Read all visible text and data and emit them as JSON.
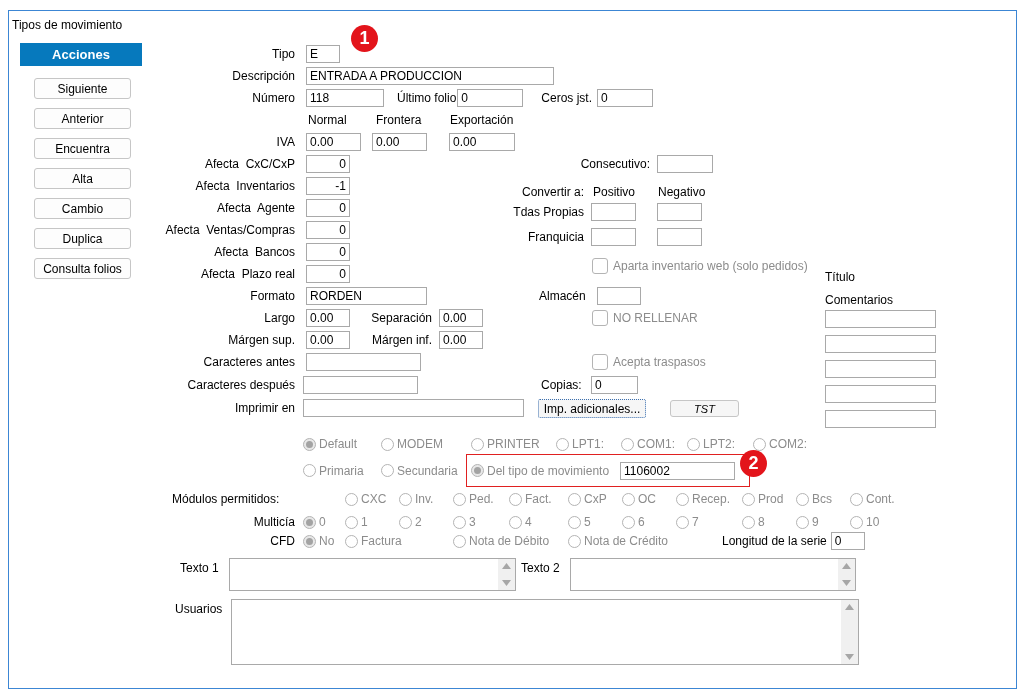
{
  "window": {
    "title": "Tipos de movimiento"
  },
  "actions": {
    "header": "Acciones",
    "buttons": [
      "Siguiente",
      "Anterior",
      "Encuentra",
      "Alta",
      "Cambio",
      "Duplica",
      "Consulta folios"
    ]
  },
  "tipo": {
    "label": "Tipo",
    "value": "E"
  },
  "descripcion": {
    "label": "Descripción",
    "value": "ENTRADA A PRODUCCION"
  },
  "numero": {
    "label": "Número",
    "value": "118"
  },
  "ultimo_folio": {
    "label": "Último folio",
    "value": "0"
  },
  "ceros": {
    "label": "Ceros jst.",
    "value": "0"
  },
  "iva": {
    "label": "IVA",
    "columns": [
      "Normal",
      "Frontera",
      "Exportación"
    ],
    "values": [
      "0.00",
      "0.00",
      "0.00"
    ]
  },
  "afecta": [
    {
      "label": "Afecta  CxC/CxP",
      "value": "0"
    },
    {
      "label": "Afecta  Inventarios",
      "value": "-1"
    },
    {
      "label": "Afecta  Agente",
      "value": "0"
    },
    {
      "label": "Afecta  Ventas/Compras",
      "value": "0"
    },
    {
      "label": "Afecta  Bancos",
      "value": "0"
    },
    {
      "label": "Afecta  Plazo real",
      "value": "0"
    }
  ],
  "consecutivo": {
    "label": "Consecutivo:"
  },
  "convertir": {
    "label": "Convertir a:",
    "columns": [
      "Positivo",
      "Negativo"
    ],
    "rows": [
      "Tdas Propias",
      "Franquicia"
    ]
  },
  "aparta_web": {
    "label": "Aparta inventario web (solo pedidos)",
    "checked": false
  },
  "titulo": {
    "label": "Título"
  },
  "comentarios": {
    "label": "Comentarios"
  },
  "formato": {
    "label": "Formato",
    "value": "RORDEN"
  },
  "almacen": {
    "label": "Almacén"
  },
  "largo": {
    "label": "Largo",
    "value": "0.00"
  },
  "separacion": {
    "label": "Separación",
    "value": "0.00"
  },
  "margen_sup": {
    "label": "Márgen sup.",
    "value": "0.00"
  },
  "margen_inf": {
    "label": "Márgen inf.",
    "value": "0.00"
  },
  "no_rellenar": {
    "label": "NO RELLENAR",
    "checked": false
  },
  "caracteres_antes": {
    "label": "Caracteres antes"
  },
  "acepta_traspasos": {
    "label": "Acepta traspasos",
    "checked": false
  },
  "caracteres_despues": {
    "label": "Caracteres después"
  },
  "copias": {
    "label": "Copias:",
    "value": "0"
  },
  "imprimir_en": {
    "label": "Imprimir en"
  },
  "print_buttons": [
    "Imp. adicionales...",
    "TST"
  ],
  "output_options": [
    {
      "label": "Default",
      "selected": true
    },
    {
      "label": "MODEM",
      "selected": false
    },
    {
      "label": "PRINTER",
      "selected": false
    },
    {
      "label": "LPT1:",
      "selected": false
    },
    {
      "label": "COM1:",
      "selected": false
    },
    {
      "label": "LPT2:",
      "selected": false
    },
    {
      "label": "COM2:",
      "selected": false
    }
  ],
  "source_options": [
    {
      "label": "Primaria",
      "selected": false
    },
    {
      "label": "Secundaria",
      "selected": false
    },
    {
      "label": "Del tipo de movimiento",
      "selected": true,
      "value": "1106002",
      "highlighted": true
    }
  ],
  "modulos": {
    "label": "Módulos permitidos:",
    "options": [
      {
        "label": "CXC",
        "selected": false
      },
      {
        "label": "Inv.",
        "selected": false
      },
      {
        "label": "Ped.",
        "selected": false
      },
      {
        "label": "Fact.",
        "selected": false
      },
      {
        "label": "CxP",
        "selected": false
      },
      {
        "label": "OC",
        "selected": false
      },
      {
        "label": "Recep.",
        "selected": false
      },
      {
        "label": "Prod",
        "selected": false
      },
      {
        "label": "Bcs",
        "selected": false
      },
      {
        "label": "Cont.",
        "selected": false
      }
    ]
  },
  "multicia": {
    "label": "Multicía",
    "options": [
      {
        "label": "0",
        "selected": true
      },
      {
        "label": "1",
        "selected": false
      },
      {
        "label": "2",
        "selected": false
      },
      {
        "label": "3",
        "selected": false
      },
      {
        "label": "4",
        "selected": false
      },
      {
        "label": "5",
        "selected": false
      },
      {
        "label": "6",
        "selected": false
      },
      {
        "label": "7",
        "selected": false
      },
      {
        "label": "8",
        "selected": false
      },
      {
        "label": "9",
        "selected": false
      },
      {
        "label": "10",
        "selected": false
      }
    ]
  },
  "cfd": {
    "label": "CFD",
    "options": [
      {
        "label": "No",
        "selected": true
      },
      {
        "label": "Factura",
        "selected": false
      },
      {
        "label": "Nota de Débito",
        "selected": false
      },
      {
        "label": "Nota de Crédito",
        "selected": false
      }
    ]
  },
  "longitud_serie": {
    "label": "Longitud de la serie",
    "value": "0"
  },
  "texto_1": {
    "label": "Texto 1"
  },
  "texto_2": {
    "label": "Texto 2"
  },
  "usuarios": {
    "label": "Usuarios"
  },
  "callouts": [
    "1",
    "2"
  ]
}
